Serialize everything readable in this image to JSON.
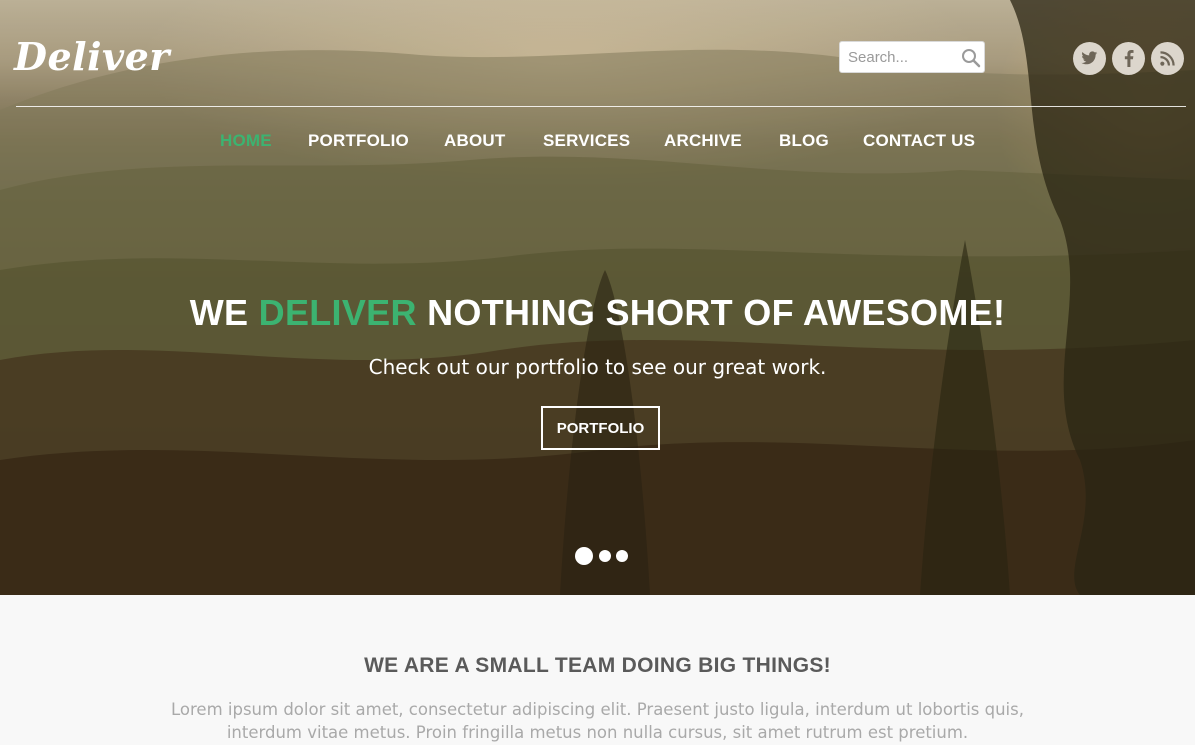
{
  "brand": {
    "logo_text": "Deliver",
    "accent_color": "#3cb371"
  },
  "search": {
    "placeholder": "Search...",
    "icon": "search-icon"
  },
  "social": [
    {
      "name": "twitter",
      "icon": "twitter-icon"
    },
    {
      "name": "facebook",
      "icon": "facebook-icon"
    },
    {
      "name": "rss",
      "icon": "rss-icon"
    }
  ],
  "nav": {
    "items": [
      {
        "label": "HOME",
        "active": true
      },
      {
        "label": "PORTFOLIO",
        "active": false
      },
      {
        "label": "ABOUT",
        "active": false
      },
      {
        "label": "SERVICES",
        "active": false
      },
      {
        "label": "ARCHIVE",
        "active": false
      },
      {
        "label": "BLOG",
        "active": false
      },
      {
        "label": "CONTACT US",
        "active": false
      }
    ]
  },
  "hero": {
    "headline_pre": "WE ",
    "headline_accent": "DELIVER",
    "headline_post": " NOTHING SHORT OF AWESOME!",
    "subline": "Check out our portfolio to see our great work.",
    "cta_label": "PORTFOLIO",
    "slides_total": 3,
    "active_slide": 1
  },
  "about": {
    "title": "WE ARE A SMALL TEAM DOING BIG THINGS!",
    "text": "Lorem ipsum dolor sit amet, consectetur adipiscing elit. Praesent justo ligula, interdum ut lobortis quis, interdum vitae metus. Proin fringilla metus non nulla cursus, sit amet rutrum est pretium."
  }
}
